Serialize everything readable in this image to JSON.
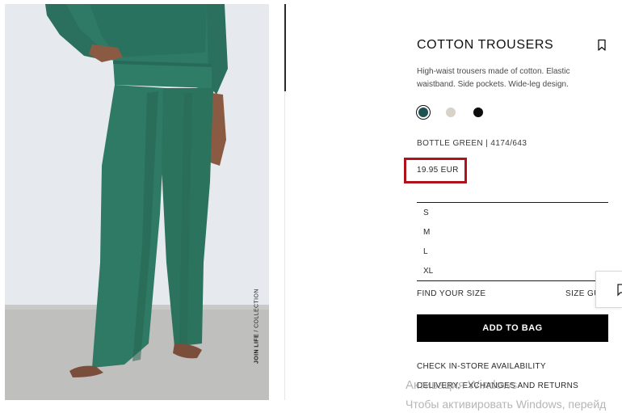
{
  "photo": {
    "caption_bold": "JOIN LIFE",
    "caption_rest": " / COLLECTION"
  },
  "product": {
    "title": "COTTON TROUSERS",
    "description": "High-waist trousers made of cotton. Elastic waistband. Side pockets. Wide-leg design.",
    "colors": [
      {
        "name": "bottle-green",
        "hex": "#1f5151",
        "selected": true
      },
      {
        "name": "beige",
        "hex": "#d8d2c8",
        "selected": false
      },
      {
        "name": "black",
        "hex": "#0d0d0d",
        "selected": false
      }
    ],
    "color_ref": "BOTTLE GREEN | 4174/643",
    "price": "19.95 EUR",
    "sizes": [
      "S",
      "M",
      "L",
      "XL"
    ]
  },
  "actions": {
    "find_size": "FIND YOUR SIZE",
    "size_guide": "SIZE GUIDE",
    "add_to_bag": "ADD TO BAG",
    "check_store": "CHECK IN-STORE AVAILABILITY",
    "delivery": "DELIVERY, EXCHANGES AND RETURNS"
  },
  "watermark": {
    "line1": "Активация Windows",
    "line2": "Чтобы активировать Windows, перейд"
  },
  "colors": {
    "highlight": "#b0121b",
    "pants_green": "#2f7a64"
  },
  "icons": {
    "bookmark": "bookmark-icon",
    "chat": "chat-icon"
  }
}
